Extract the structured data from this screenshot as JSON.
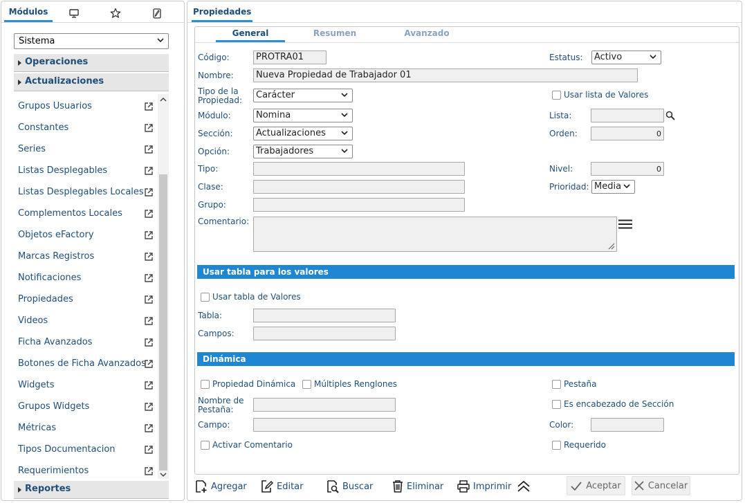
{
  "left": {
    "tabs": {
      "modulos": "Módulos"
    },
    "tab_icons": [
      "monitor-icon",
      "star-icon",
      "wrench-icon"
    ],
    "module_select": "Sistema",
    "sections": {
      "operaciones": "Operaciones",
      "actualizaciones": "Actualizaciones",
      "reportes": "Reportes"
    },
    "items": [
      "Grupos Usuarios",
      "Constantes",
      "Series",
      "Listas Desplegables",
      "Listas Desplegables Locales",
      "Complementos Locales",
      "Objetos eFactory",
      "Marcas Registros",
      "Notificaciones",
      "Propiedades",
      "Videos",
      "Ficha Avanzados",
      "Botones de Ficha Avanzados",
      "Widgets",
      "Grupos Widgets",
      "Métricas",
      "Tipos Documentacion",
      "Requerimientos"
    ]
  },
  "right": {
    "tab": "Propiedades",
    "inner_tabs": {
      "general": "General",
      "resumen": "Resumen",
      "avanzado": "Avanzado"
    },
    "form": {
      "codigo_label": "Código:",
      "codigo": "PROTRA01",
      "nombre_label": "Nombre:",
      "nombre": "Nueva Propiedad de Trabajador 01",
      "tipo_prop_label1": "Tipo de la",
      "tipo_prop_label2": "Propiedad:",
      "tipo_prop": "Carácter",
      "modulo_label": "Módulo:",
      "modulo": "Nomina",
      "seccion_label": "Sección:",
      "seccion": "Actualizaciones",
      "opcion_label": "Opción:",
      "opcion": "Trabajadores",
      "tipo_label": "Tipo:",
      "clase_label": "Clase:",
      "grupo_label": "Grupo:",
      "comentario_label": "Comentario:",
      "estatus_label": "Estatus:",
      "estatus": "Activo",
      "usar_lista_label": "Usar lista de Valores",
      "lista_label": "Lista:",
      "orden_label": "Orden:",
      "orden": "0",
      "nivel_label": "Nivel:",
      "nivel": "0",
      "prioridad_label": "Prioridad:",
      "prioridad": "Media"
    },
    "tabla_section": {
      "title": "Usar tabla para los valores",
      "usar_tabla_label": "Usar tabla de Valores",
      "tabla_label": "Tabla:",
      "campos_label": "Campos:"
    },
    "dinamica_section": {
      "title": "Dinámica",
      "prop_dinamica_label": "Propiedad Dinámica",
      "multiples_label": "Múltiples Renglones",
      "pestana_label": "Pestaña",
      "nombre_pestana_label1": "Nombre de",
      "nombre_pestana_label2": "Pestaña:",
      "encabezado_label": "Es encabezado de Sección",
      "campo_label": "Campo:",
      "color_label": "Color:",
      "activar_comentario_label": "Activar Comentario",
      "requerido_label": "Requerido"
    },
    "toolbar": {
      "agregar": "Agregar",
      "editar": "Editar",
      "buscar": "Buscar",
      "eliminar": "Eliminar",
      "imprimir": "Imprimir",
      "aceptar": "Aceptar",
      "cancelar": "Cancelar"
    }
  }
}
